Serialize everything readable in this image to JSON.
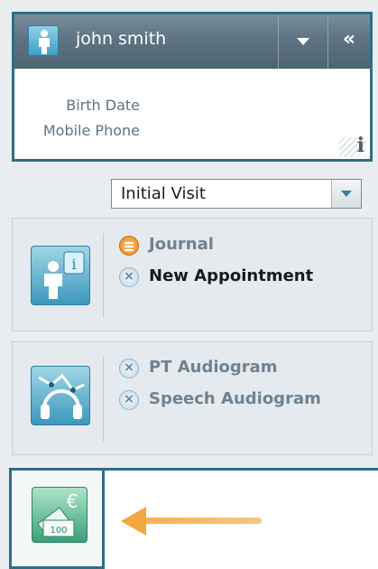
{
  "patient": {
    "name": "john smith",
    "fields": [
      "Birth Date",
      "Mobile Phone"
    ],
    "info_glyph": "i"
  },
  "header_controls": {
    "dropdown_icon": "chevron-down-icon",
    "collapse_glyph": "«"
  },
  "visit": {
    "selected": "Initial Visit"
  },
  "panels": [
    {
      "icon": "person-info-icon",
      "items": [
        {
          "label": "Journal",
          "icon": "journal-icon"
        },
        {
          "label": "New Appointment",
          "icon": "close-circle-icon"
        }
      ]
    },
    {
      "icon": "audiogram-headphones-icon",
      "items": [
        {
          "label": "PT Audiogram",
          "icon": "close-circle-icon"
        },
        {
          "label": "Speech Audiogram",
          "icon": "close-circle-icon"
        }
      ]
    }
  ],
  "billing": {
    "icon": "euro-money-icon",
    "euro_symbol": "€",
    "banknote_value": "100"
  },
  "colors": {
    "frame": "#2d6e84",
    "header": "#5e7482",
    "accent_arrow": "#f4a640",
    "journal_orange": "#e88422"
  }
}
